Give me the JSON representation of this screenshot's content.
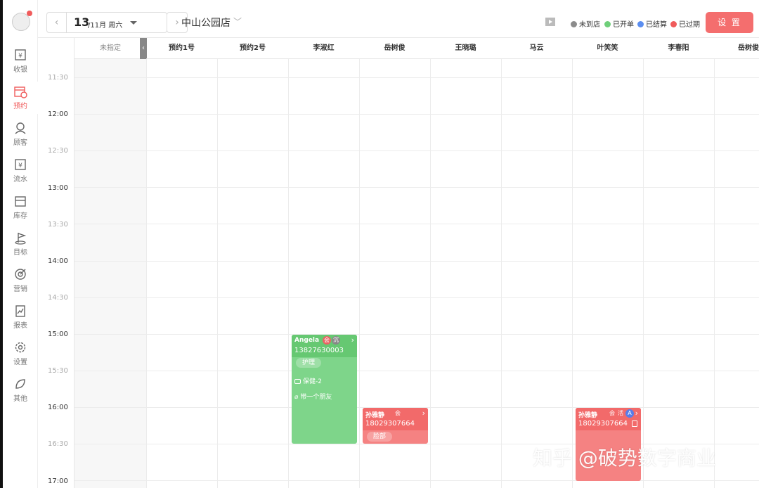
{
  "sidebar": {
    "items": [
      {
        "label": "收银",
        "icon": "cashier-icon"
      },
      {
        "label": "预约",
        "icon": "calendar-icon",
        "active": true
      },
      {
        "label": "顾客",
        "icon": "customer-icon"
      },
      {
        "label": "流水",
        "icon": "ledger-icon"
      },
      {
        "label": "库存",
        "icon": "inventory-icon"
      },
      {
        "label": "目标",
        "icon": "target-flag-icon"
      },
      {
        "label": "营销",
        "icon": "marketing-icon"
      },
      {
        "label": "报表",
        "icon": "report-icon"
      },
      {
        "label": "设置",
        "icon": "gear-icon"
      },
      {
        "label": "其他",
        "icon": "leaf-icon"
      }
    ]
  },
  "header": {
    "date_day": "13",
    "date_rest": "/11月 周六",
    "store": "中山公园店",
    "legend": [
      {
        "label": "未到店",
        "color": "#8c8c8c"
      },
      {
        "label": "已开单",
        "color": "#6fcf7a"
      },
      {
        "label": "已结算",
        "color": "#5b8ef0"
      },
      {
        "label": "已过期",
        "color": "#f05b5b"
      }
    ],
    "settings_label": "设 置"
  },
  "columns": [
    "未指定",
    "预约1号",
    "预约2号",
    "李淑红",
    "岳树俊",
    "王晓璐",
    "马云",
    "叶笑笑",
    "李春阳",
    "岳树俊"
  ],
  "times": [
    "11:30",
    "12:00",
    "12:30",
    "13:00",
    "13:30",
    "14:00",
    "14:30",
    "15:00",
    "15:30",
    "16:00",
    "16:30",
    "17:00"
  ],
  "appointments": [
    {
      "name": "Angela",
      "badges": [
        "会",
        "沉"
      ],
      "phone": "13827630003",
      "tag": "护理",
      "room": "保健-2",
      "note": "带一个朋友"
    },
    {
      "name": "孙雅静",
      "badges": [
        "会"
      ],
      "phone": "18029307664",
      "tag": "脸部"
    },
    {
      "name": "孙雅静",
      "badges": [
        "会",
        "活",
        "A"
      ],
      "phone": "18029307664"
    }
  ],
  "watermark": "知乎 @破势数字商业"
}
